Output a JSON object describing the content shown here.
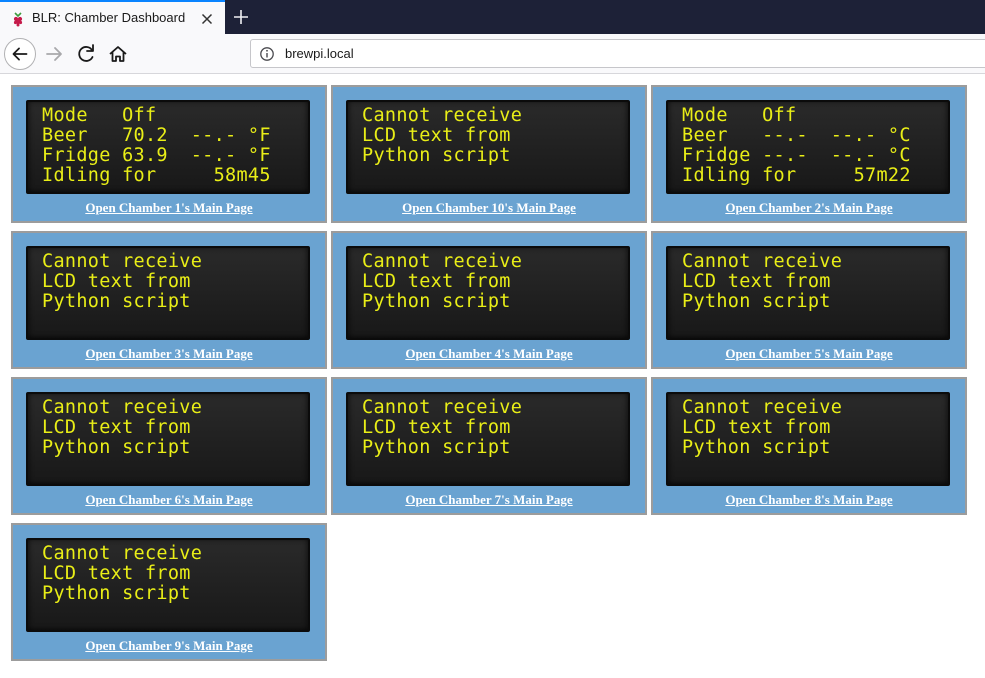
{
  "browser": {
    "tab_title": "BLR: Chamber Dashboard",
    "url": "brewpi.local"
  },
  "chambers": [
    {
      "lcd": [
        "Mode   Off",
        "Beer   70.2  --.- °F",
        "Fridge 63.9  --.- °F",
        "Idling for     58m45"
      ],
      "link": "Open Chamber 1's Main Page"
    },
    {
      "lcd": [
        "Cannot receive",
        "LCD text from",
        "Python script",
        ""
      ],
      "link": "Open Chamber 10's Main Page"
    },
    {
      "lcd": [
        "Mode   Off",
        "Beer   --.-  --.- °C",
        "Fridge --.-  --.- °C",
        "Idling for     57m22"
      ],
      "link": "Open Chamber 2's Main Page"
    },
    {
      "lcd": [
        "Cannot receive",
        "LCD text from",
        "Python script",
        ""
      ],
      "link": "Open Chamber 3's Main Page"
    },
    {
      "lcd": [
        "Cannot receive",
        "LCD text from",
        "Python script",
        ""
      ],
      "link": "Open Chamber 4's Main Page"
    },
    {
      "lcd": [
        "Cannot receive",
        "LCD text from",
        "Python script",
        ""
      ],
      "link": "Open Chamber 5's Main Page"
    },
    {
      "lcd": [
        "Cannot receive",
        "LCD text from",
        "Python script",
        ""
      ],
      "link": "Open Chamber 6's Main Page"
    },
    {
      "lcd": [
        "Cannot receive",
        "LCD text from",
        "Python script",
        ""
      ],
      "link": "Open Chamber 7's Main Page"
    },
    {
      "lcd": [
        "Cannot receive",
        "LCD text from",
        "Python script",
        ""
      ],
      "link": "Open Chamber 8's Main Page"
    },
    {
      "lcd": [
        "Cannot receive",
        "LCD text from",
        "Python script",
        ""
      ],
      "link": "Open Chamber 9's Main Page"
    }
  ],
  "icons": {
    "favicon": "raspberry-icon",
    "tab_close": "close-icon",
    "new_tab": "plus-icon",
    "back": "arrow-left-icon",
    "forward": "arrow-right-icon",
    "reload": "reload-icon",
    "home": "home-icon",
    "site_info": "info-icon"
  },
  "colors": {
    "chamber_bg": "#6aa3d1",
    "lcd_text": "#e9ee17",
    "lcd_bg": "#1e1e1e",
    "tabbar_bg": "#1d2137"
  }
}
